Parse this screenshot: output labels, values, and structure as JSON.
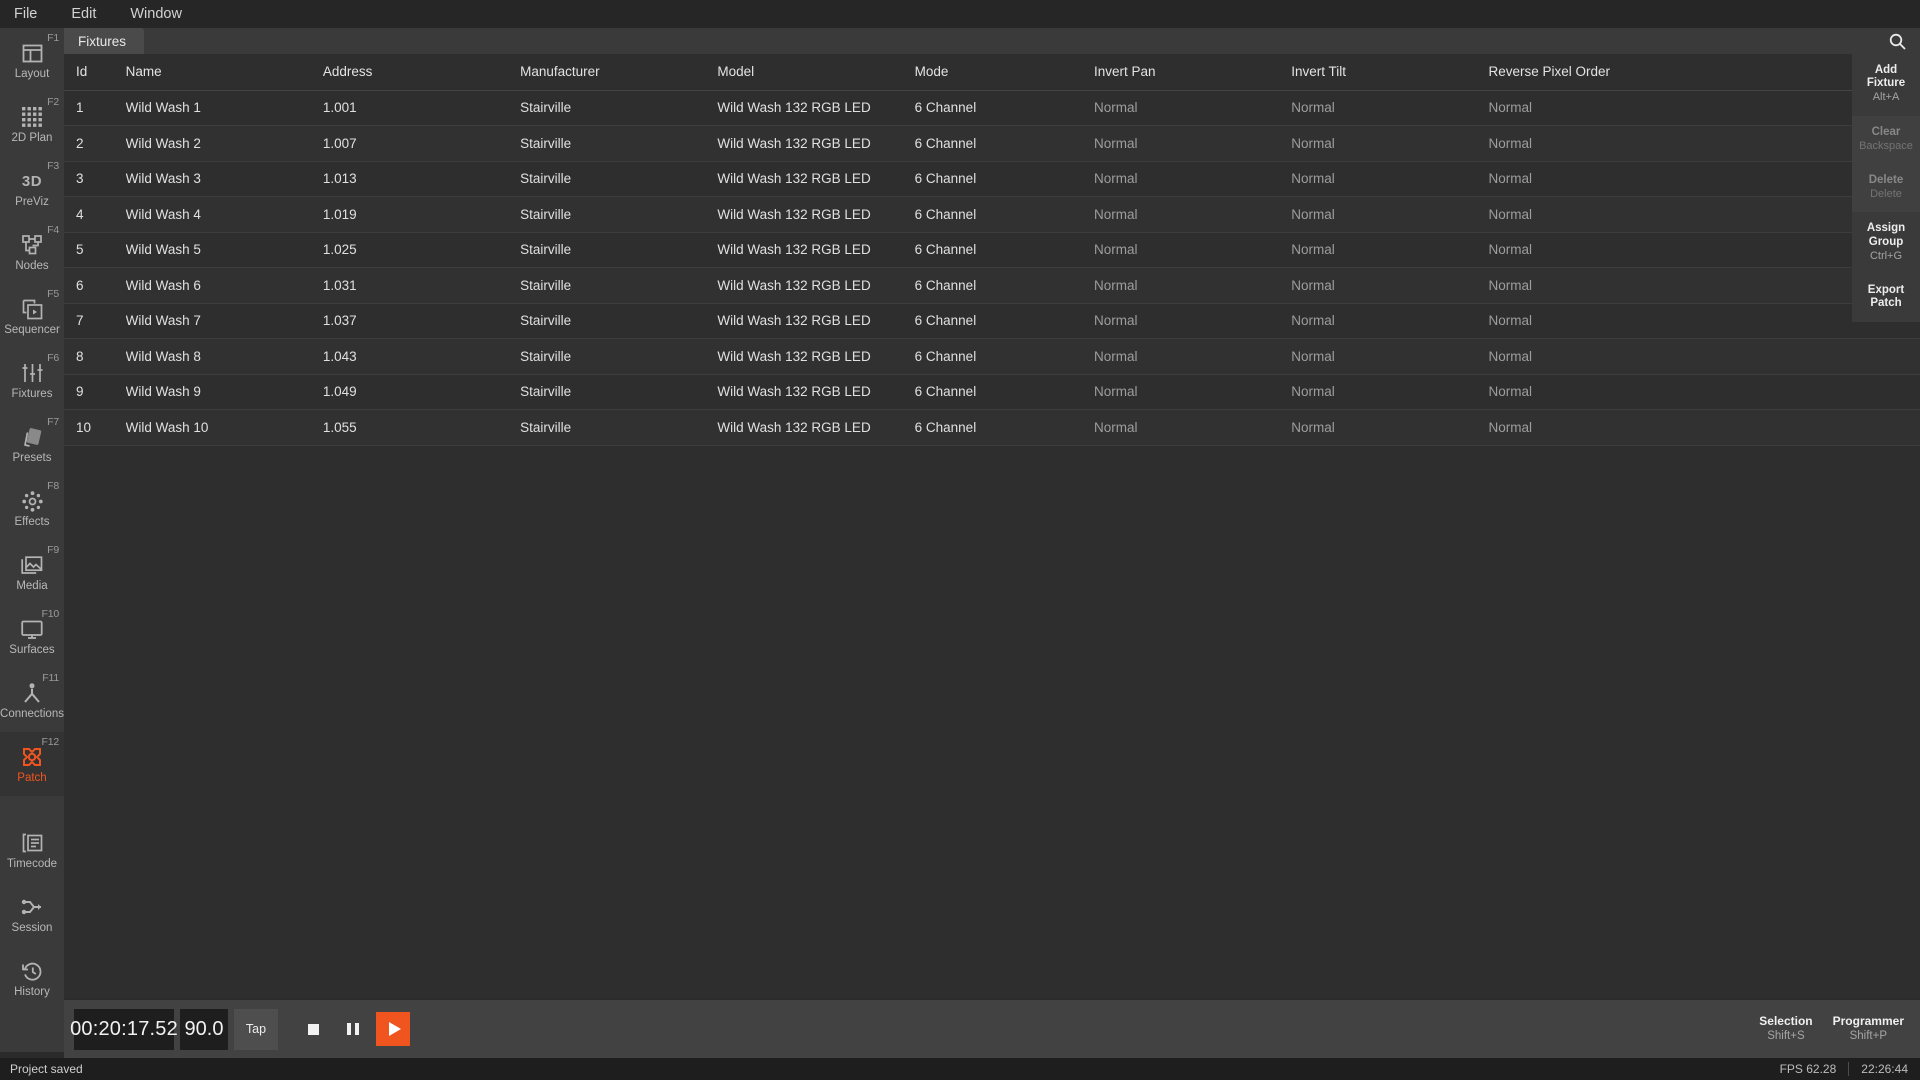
{
  "menubar": {
    "items": [
      {
        "label": "File"
      },
      {
        "label": "Edit"
      },
      {
        "label": "Window"
      }
    ]
  },
  "sidebar": {
    "items": [
      {
        "label": "Layout",
        "fkey": "F1",
        "icon": "layout-icon",
        "active": false
      },
      {
        "label": "2D Plan",
        "fkey": "F2",
        "icon": "grid-icon",
        "active": false
      },
      {
        "label": "PreViz",
        "fkey": "F3",
        "icon": "3d-icon",
        "active": false
      },
      {
        "label": "Nodes",
        "fkey": "F4",
        "icon": "nodes-icon",
        "active": false
      },
      {
        "label": "Sequencer",
        "fkey": "F5",
        "icon": "sequencer-icon",
        "active": false
      },
      {
        "label": "Fixtures",
        "fkey": "F6",
        "icon": "faders-icon",
        "active": false
      },
      {
        "label": "Presets",
        "fkey": "F7",
        "icon": "presets-icon",
        "active": false
      },
      {
        "label": "Effects",
        "fkey": "F8",
        "icon": "effects-icon",
        "active": false
      },
      {
        "label": "Media",
        "fkey": "F9",
        "icon": "media-icon",
        "active": false
      },
      {
        "label": "Surfaces",
        "fkey": "F10",
        "icon": "monitor-icon",
        "active": false
      },
      {
        "label": "Connections",
        "fkey": "F11",
        "icon": "connections-icon",
        "active": false
      },
      {
        "label": "Patch",
        "fkey": "F12",
        "icon": "patch-icon",
        "active": true
      }
    ],
    "bottom_items": [
      {
        "label": "Timecode",
        "icon": "timecode-icon"
      },
      {
        "label": "Session",
        "icon": "session-icon"
      },
      {
        "label": "History",
        "icon": "history-icon"
      }
    ]
  },
  "panel": {
    "tab_title": "Fixtures",
    "search_icon": "search-icon"
  },
  "table": {
    "columns": [
      {
        "key": "id",
        "label": "Id",
        "dim": false
      },
      {
        "key": "name",
        "label": "Name",
        "dim": false
      },
      {
        "key": "address",
        "label": "Address",
        "dim": false
      },
      {
        "key": "manufacturer",
        "label": "Manufacturer",
        "dim": false
      },
      {
        "key": "model",
        "label": "Model",
        "dim": false
      },
      {
        "key": "mode",
        "label": "Mode",
        "dim": false
      },
      {
        "key": "invert_pan",
        "label": "Invert Pan",
        "dim": false
      },
      {
        "key": "invert_tilt",
        "label": "Invert Tilt",
        "dim": false
      },
      {
        "key": "reverse_pixel_order",
        "label": "Reverse Pixel Order",
        "dim": false
      }
    ],
    "rows": [
      {
        "id": "1",
        "name": "Wild Wash 1",
        "address": "1.001",
        "manufacturer": "Stairville",
        "model": "Wild Wash 132 RGB LED",
        "mode": "6 Channel",
        "invert_pan": "Normal",
        "invert_tilt": "Normal",
        "reverse_pixel_order": "Normal"
      },
      {
        "id": "2",
        "name": "Wild Wash 2",
        "address": "1.007",
        "manufacturer": "Stairville",
        "model": "Wild Wash 132 RGB LED",
        "mode": "6 Channel",
        "invert_pan": "Normal",
        "invert_tilt": "Normal",
        "reverse_pixel_order": "Normal"
      },
      {
        "id": "3",
        "name": "Wild Wash 3",
        "address": "1.013",
        "manufacturer": "Stairville",
        "model": "Wild Wash 132 RGB LED",
        "mode": "6 Channel",
        "invert_pan": "Normal",
        "invert_tilt": "Normal",
        "reverse_pixel_order": "Normal"
      },
      {
        "id": "4",
        "name": "Wild Wash 4",
        "address": "1.019",
        "manufacturer": "Stairville",
        "model": "Wild Wash 132 RGB LED",
        "mode": "6 Channel",
        "invert_pan": "Normal",
        "invert_tilt": "Normal",
        "reverse_pixel_order": "Normal"
      },
      {
        "id": "5",
        "name": "Wild Wash 5",
        "address": "1.025",
        "manufacturer": "Stairville",
        "model": "Wild Wash 132 RGB LED",
        "mode": "6 Channel",
        "invert_pan": "Normal",
        "invert_tilt": "Normal",
        "reverse_pixel_order": "Normal"
      },
      {
        "id": "6",
        "name": "Wild Wash 6",
        "address": "1.031",
        "manufacturer": "Stairville",
        "model": "Wild Wash 132 RGB LED",
        "mode": "6 Channel",
        "invert_pan": "Normal",
        "invert_tilt": "Normal",
        "reverse_pixel_order": "Normal"
      },
      {
        "id": "7",
        "name": "Wild Wash 7",
        "address": "1.037",
        "manufacturer": "Stairville",
        "model": "Wild Wash 132 RGB LED",
        "mode": "6 Channel",
        "invert_pan": "Normal",
        "invert_tilt": "Normal",
        "reverse_pixel_order": "Normal"
      },
      {
        "id": "8",
        "name": "Wild Wash 8",
        "address": "1.043",
        "manufacturer": "Stairville",
        "model": "Wild Wash 132 RGB LED",
        "mode": "6 Channel",
        "invert_pan": "Normal",
        "invert_tilt": "Normal",
        "reverse_pixel_order": "Normal"
      },
      {
        "id": "9",
        "name": "Wild Wash 9",
        "address": "1.049",
        "manufacturer": "Stairville",
        "model": "Wild Wash 132 RGB LED",
        "mode": "6 Channel",
        "invert_pan": "Normal",
        "invert_tilt": "Normal",
        "reverse_pixel_order": "Normal"
      },
      {
        "id": "10",
        "name": "Wild Wash 10",
        "address": "1.055",
        "manufacturer": "Stairville",
        "model": "Wild Wash 132 RGB LED",
        "mode": "6 Channel",
        "invert_pan": "Normal",
        "invert_tilt": "Normal",
        "reverse_pixel_order": "Normal"
      }
    ]
  },
  "actions": [
    {
      "label": "Add Fixture",
      "shortcut": "Alt+A",
      "enabled": true
    },
    {
      "label": "Clear",
      "shortcut": "Backspace",
      "enabled": false
    },
    {
      "label": "Delete",
      "shortcut": "Delete",
      "enabled": false
    },
    {
      "label": "Assign Group",
      "shortcut": "Ctrl+G",
      "enabled": true
    },
    {
      "label": "Export Patch",
      "shortcut": "",
      "enabled": true
    }
  ],
  "transport": {
    "timecode": "00:20:17.52",
    "bpm": "90.0",
    "tap_label": "Tap",
    "stop_icon": "stop-icon",
    "pause_icon": "pause-icon",
    "play_icon": "play-icon",
    "right_buttons": [
      {
        "label": "Selection",
        "shortcut": "Shift+S"
      },
      {
        "label": "Programmer",
        "shortcut": "Shift+P"
      }
    ]
  },
  "statusbar": {
    "message": "Project saved",
    "fps": "FPS 62.28",
    "clock": "22:26:44"
  },
  "colors": {
    "accent": "#f1551f",
    "panel": "#3a3a3a",
    "table_bg": "#2e2e2e",
    "table_alt": "#313131",
    "status_bg": "#1e1e1e"
  }
}
